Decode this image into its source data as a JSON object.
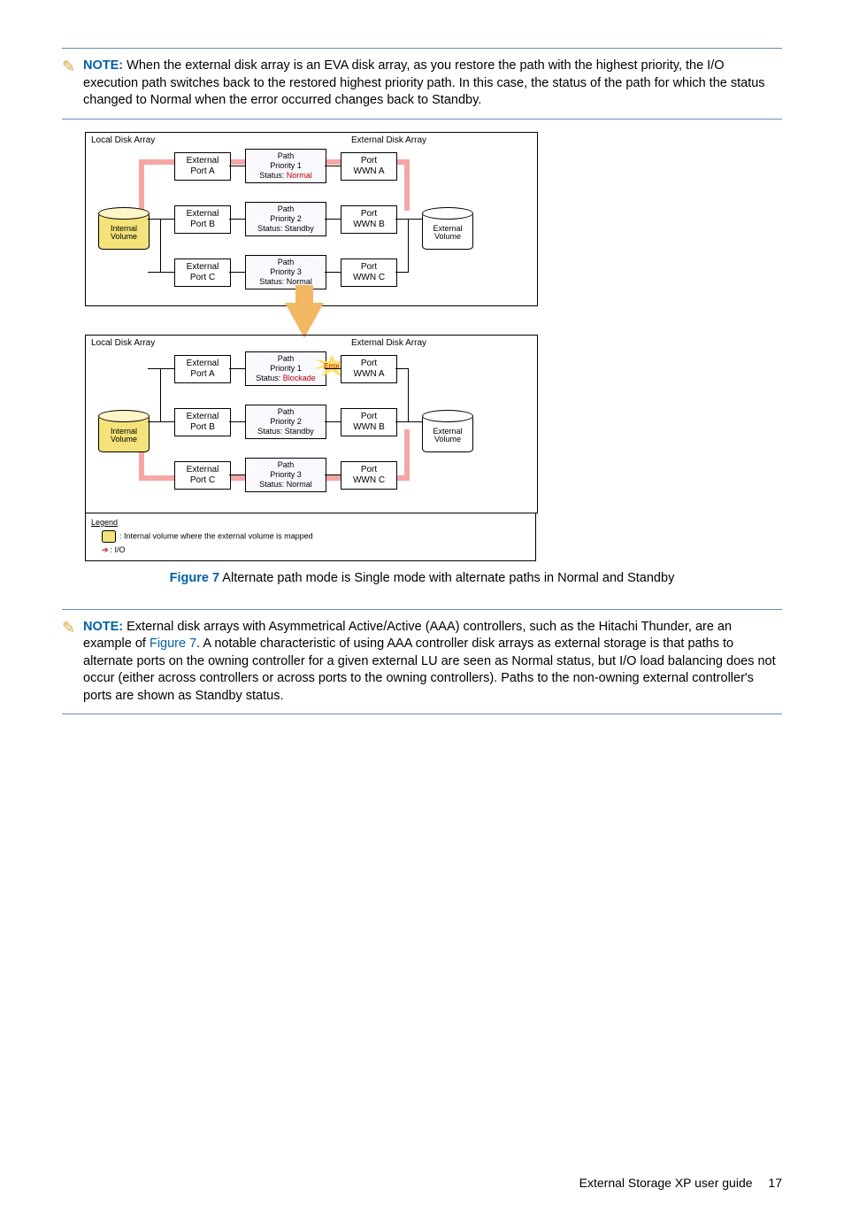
{
  "note1": {
    "label": "NOTE:",
    "text": "When the external disk array is an EVA disk array, as you restore the path with the highest priority, the I/O execution path switches back to the restored highest priority path. In this case, the status of the path for which the status changed to Normal when the error occurred changes back to Standby."
  },
  "diagram": {
    "top": {
      "local": "Local Disk Array",
      "external": "External Disk Array",
      "int_vol": "Internal\nVolume",
      "ext_vol": "External\nVolume",
      "ports": [
        {
          "ep": "External\nPort A",
          "path": "Path\nPriority 1",
          "status_lbl": "Status:",
          "status": "Normal",
          "wp": "Port\nWWN A"
        },
        {
          "ep": "External\nPort B",
          "path": "Path\nPriority 2",
          "status_lbl": "Status:",
          "status": "Standby",
          "wp": "Port\nWWN B"
        },
        {
          "ep": "External\nPort C",
          "path": "Path\nPriority 3",
          "status_lbl": "Status:",
          "status": "Normal",
          "wp": "Port\nWWN C"
        }
      ]
    },
    "bottom": {
      "local": "Local Disk Array",
      "external": "External Disk Array",
      "int_vol": "Internal\nVolume",
      "ext_vol": "External\nVolume",
      "error": "Error",
      "ports": [
        {
          "ep": "External\nPort A",
          "path": "Path\nPriority 1",
          "status_lbl": "Status:",
          "status": "Blockade",
          "wp": "Port\nWWN A"
        },
        {
          "ep": "External\nPort B",
          "path": "Path\nPriority 2",
          "status_lbl": "Status:",
          "status": "Standby",
          "wp": "Port\nWWN B"
        },
        {
          "ep": "External\nPort C",
          "path": "Path\nPriority 3",
          "status_lbl": "Status:",
          "status": "Normal",
          "wp": "Port\nWWN C"
        }
      ]
    },
    "legend": {
      "title": "Legend",
      "item1": ": Internal volume where the external volume is mapped",
      "item2": ": I/O"
    }
  },
  "figure": {
    "label": "Figure 7",
    "caption": "Alternate path mode is Single mode with alternate paths in Normal and Standby"
  },
  "note2": {
    "label": "NOTE:",
    "pre": "External disk arrays with Asymmetrical Active/Active (AAA) controllers, such as the Hitachi Thunder, are an example of ",
    "xref": "Figure 7",
    "post": ". A notable characteristic of using AAA controller disk arrays as external storage is that paths to alternate ports on the owning controller for a given external LU are seen as Normal status, but I/O load balancing does not occur (either across controllers or across ports to the owning controllers). Paths to the non-owning external controller's ports are shown as Standby status."
  },
  "footer": {
    "title": "External Storage XP user guide",
    "page": "17"
  }
}
